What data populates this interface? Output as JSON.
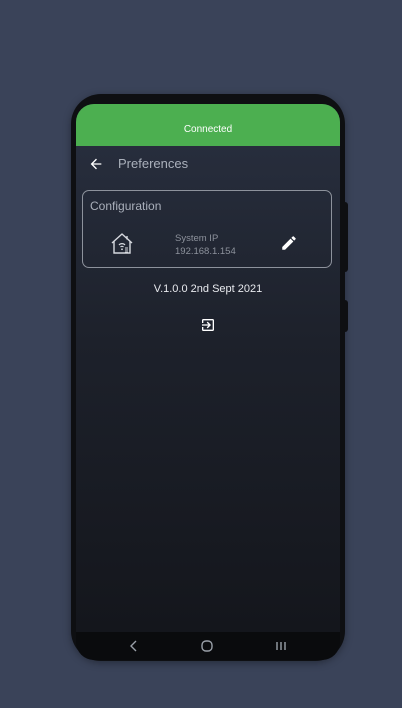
{
  "status": {
    "text": "Connected",
    "color": "#4caf50"
  },
  "header": {
    "title": "Preferences",
    "back_icon": "arrow-left-icon"
  },
  "configuration": {
    "title": "Configuration",
    "icon": "smart-home-icon",
    "system_ip_label": "System IP",
    "system_ip_value": "192.168.1.154",
    "edit_icon": "pencil-icon"
  },
  "version": "V.1.0.0 2nd Sept 2021",
  "logout_icon": "logout-icon",
  "nav": {
    "back_icon": "nav-back-icon",
    "home_icon": "nav-home-icon",
    "recent_icon": "nav-recent-apps-icon"
  },
  "colors": {
    "background": "#3a4359",
    "accent": "#4caf50",
    "text_muted": "#aab0bb"
  }
}
